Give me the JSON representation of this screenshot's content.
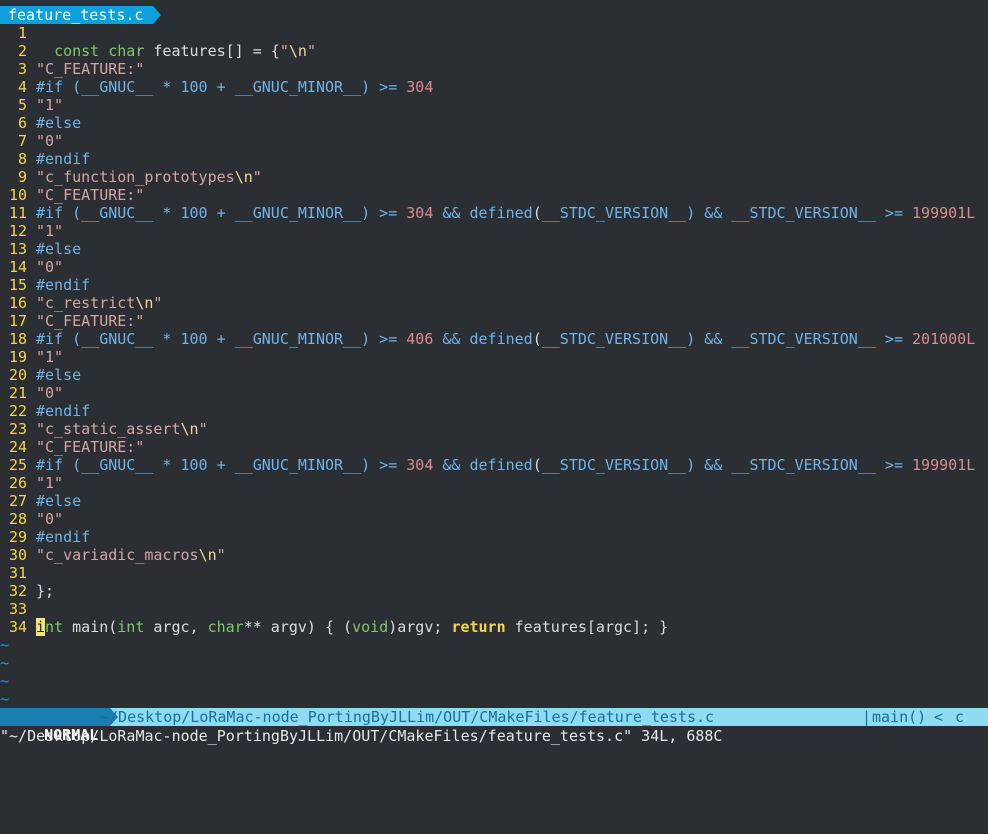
{
  "tab": {
    "filename": "feature_tests.c"
  },
  "code_lines": [
    {
      "n": "1",
      "text": ""
    },
    {
      "n": "2",
      "text": "  const char features[] = {\"\\n\""
    },
    {
      "n": "3",
      "text": "\"C_FEATURE:\""
    },
    {
      "n": "4",
      "text": "#if (__GNUC__ * 100 + __GNUC_MINOR__) >= 304"
    },
    {
      "n": "5",
      "text": "\"1\""
    },
    {
      "n": "6",
      "text": "#else"
    },
    {
      "n": "7",
      "text": "\"0\""
    },
    {
      "n": "8",
      "text": "#endif"
    },
    {
      "n": "9",
      "text": "\"c_function_prototypes\\n\""
    },
    {
      "n": "10",
      "text": "\"C_FEATURE:\""
    },
    {
      "n": "11",
      "text": "#if (__GNUC__ * 100 + __GNUC_MINOR__) >= 304 && defined(__STDC_VERSION__) && __STDC_VERSION__ >= 199901L"
    },
    {
      "n": "12",
      "text": "\"1\""
    },
    {
      "n": "13",
      "text": "#else"
    },
    {
      "n": "14",
      "text": "\"0\""
    },
    {
      "n": "15",
      "text": "#endif"
    },
    {
      "n": "16",
      "text": "\"c_restrict\\n\""
    },
    {
      "n": "17",
      "text": "\"C_FEATURE:\""
    },
    {
      "n": "18",
      "text": "#if (__GNUC__ * 100 + __GNUC_MINOR__) >= 406 && defined(__STDC_VERSION__) && __STDC_VERSION__ >= 201000L"
    },
    {
      "n": "19",
      "text": "\"1\""
    },
    {
      "n": "20",
      "text": "#else"
    },
    {
      "n": "21",
      "text": "\"0\""
    },
    {
      "n": "22",
      "text": "#endif"
    },
    {
      "n": "23",
      "text": "\"c_static_assert\\n\""
    },
    {
      "n": "24",
      "text": "\"C_FEATURE:\""
    },
    {
      "n": "25",
      "text": "#if (__GNUC__ * 100 + __GNUC_MINOR__) >= 304 && defined(__STDC_VERSION__) && __STDC_VERSION__ >= 199901L"
    },
    {
      "n": "26",
      "text": "\"1\""
    },
    {
      "n": "27",
      "text": "#else"
    },
    {
      "n": "28",
      "text": "\"0\""
    },
    {
      "n": "29",
      "text": "#endif"
    },
    {
      "n": "30",
      "text": "\"c_variadic_macros\\n\""
    },
    {
      "n": "31",
      "text": ""
    },
    {
      "n": "32",
      "text": "};"
    },
    {
      "n": "33",
      "text": ""
    },
    {
      "n": "34",
      "text": "int main(int argc, char** argv) { (void)argv; return features[argc]; }"
    }
  ],
  "tildes": [
    "~",
    "~",
    "~",
    "~"
  ],
  "status": {
    "mode": "NORMAL",
    "path": "~/Desktop/LoRaMac-node_PortingByJLLim/OUT/CMakeFiles/feature_tests.c",
    "separator": "|",
    "function": "main()",
    "arrow": "<",
    "filetype": "c"
  },
  "cmdline": "\"~/Desktop/LoRaMac-node_PortingByJLLim/OUT/CMakeFiles/feature_tests.c\" 34L, 688C",
  "colors": {
    "background": "#2b2f33",
    "accent": "#0f9fdb",
    "line_numbers": "#f7d44a",
    "strings": "#d3a6a6",
    "preprocessor": "#6fb3e8"
  }
}
